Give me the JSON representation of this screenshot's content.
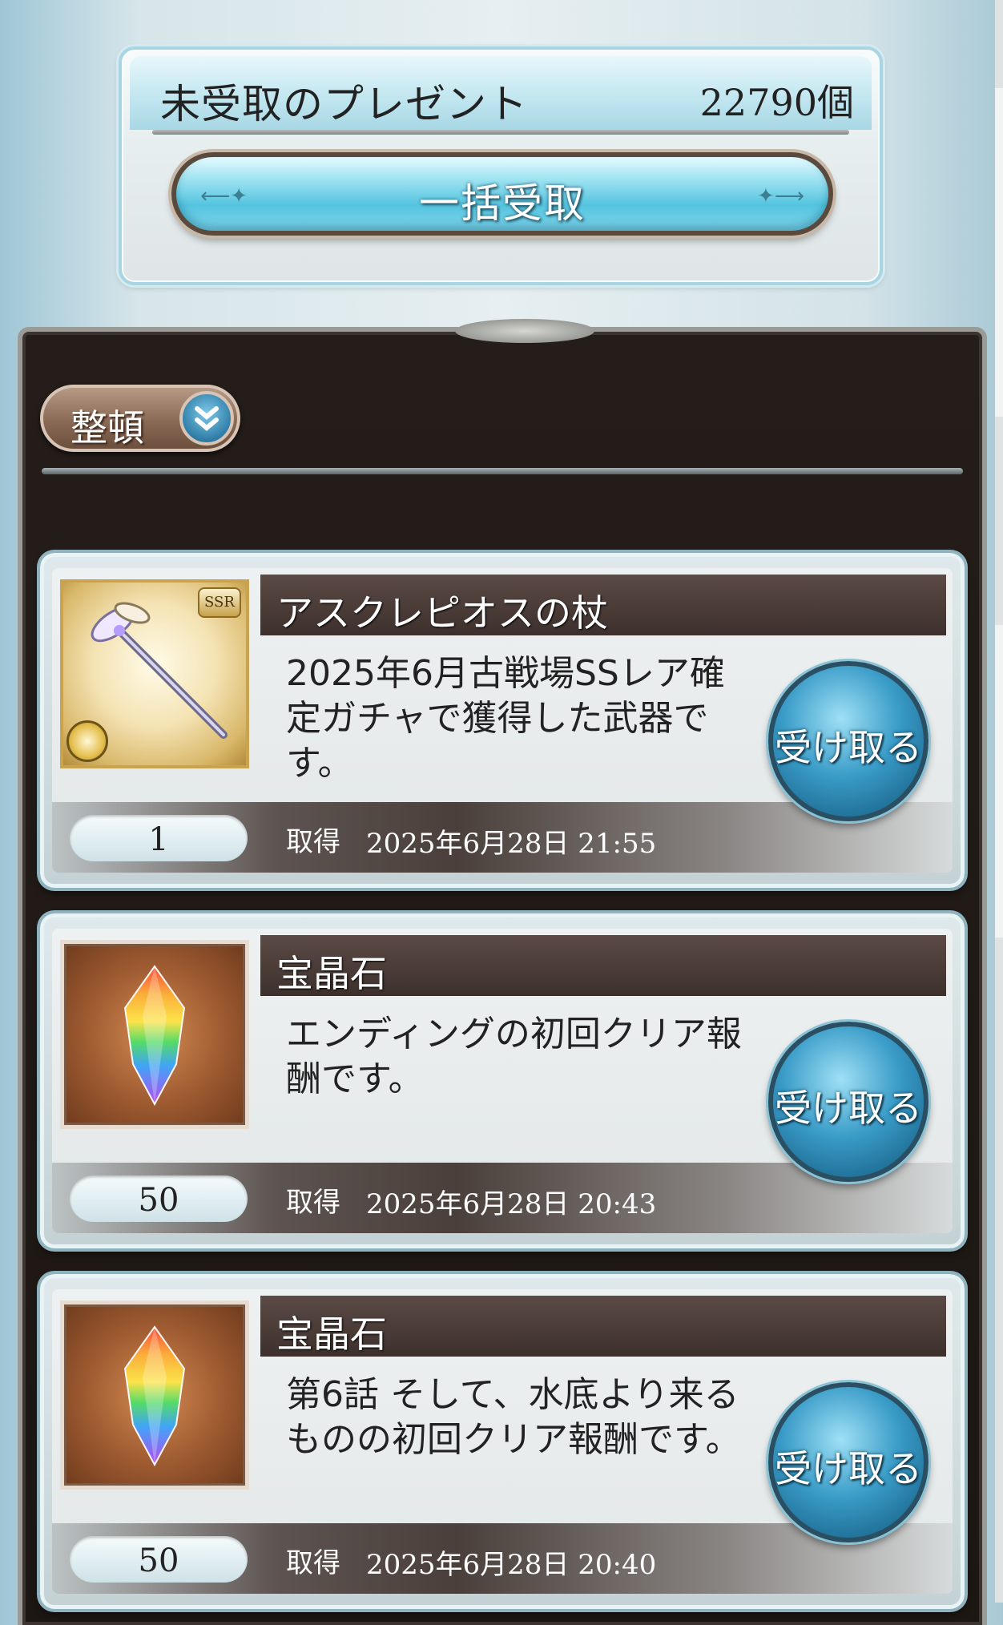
{
  "presents": {
    "title": "未受取のプレゼント",
    "count": "22790個",
    "bulk_receive_label": "一括受取"
  },
  "sort": {
    "label": "整頓",
    "icon": "chevron-double-down-icon"
  },
  "items": [
    {
      "name": "アスクレピオスの杖",
      "description": "2025年6月古戦場SSレア確定ガチャで獲得した武器です。",
      "quantity": "1",
      "obtained_label": "取得",
      "obtained_date": "2025年6月28日 21:55",
      "receive_label": "受け取る",
      "rarity_badge": "SSR",
      "icon": "staff-weapon-icon"
    },
    {
      "name": "宝晶石",
      "description": "エンディングの初回クリア報酬です。",
      "quantity": "50",
      "obtained_label": "取得",
      "obtained_date": "2025年6月28日 20:43",
      "receive_label": "受け取る",
      "icon": "rainbow-crystal-icon"
    },
    {
      "name": "宝晶石",
      "description": "第6話 そして、水底より来るものの初回クリア報酬です。",
      "quantity": "50",
      "obtained_label": "取得",
      "obtained_date": "2025年6月28日 20:40",
      "receive_label": "受け取る",
      "icon": "rainbow-crystal-icon"
    }
  ]
}
